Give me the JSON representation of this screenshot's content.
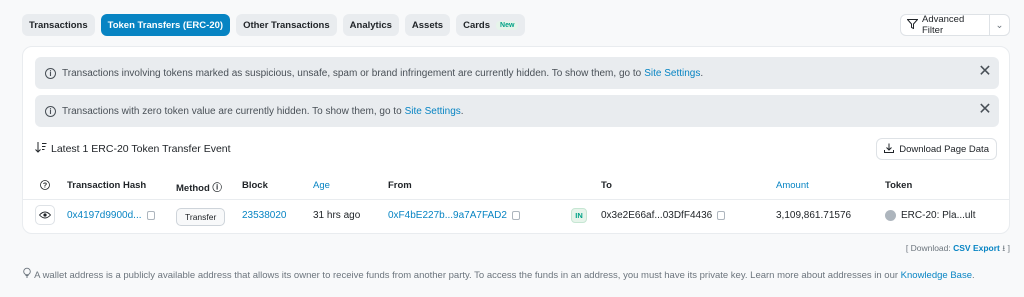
{
  "tabs": [
    {
      "label": "Transactions"
    },
    {
      "label": "Token Transfers (ERC-20)"
    },
    {
      "label": "Other Transactions"
    },
    {
      "label": "Analytics"
    },
    {
      "label": "Assets"
    },
    {
      "label": "Cards",
      "badge": "New"
    }
  ],
  "advanced_filter": {
    "label": "Advanced Filter"
  },
  "alerts": [
    {
      "text": "Transactions involving tokens marked as suspicious, unsafe, spam or brand infringement are currently hidden. To show them, go to",
      "link": "Site Settings",
      "suffix": "."
    },
    {
      "text": "Transactions with zero token value are currently hidden. To show them, go to",
      "link": "Site Settings",
      "suffix": "."
    }
  ],
  "summary": {
    "text": "Latest 1 ERC-20 Token Transfer Event"
  },
  "download_button": {
    "label": "Download Page Data"
  },
  "table": {
    "headers": {
      "hash": "Transaction Hash",
      "method": "Method",
      "block": "Block",
      "age": "Age",
      "from": "From",
      "to": "To",
      "amount": "Amount",
      "token": "Token"
    },
    "rows": [
      {
        "hash": "0x4197d9900d...",
        "method": "Transfer",
        "block": "23538020",
        "age": "31 hrs ago",
        "from": "0xF4bE227b...9a7A7FAD2",
        "direction": "IN",
        "to": "0x3e2E66af...03DfF4436",
        "amount": "3,109,861.71576",
        "token": "ERC-20: Pla...ult"
      }
    ]
  },
  "csv": {
    "prefix": "[ Download:",
    "link": "CSV Export",
    "suffix": "]"
  },
  "footnote": {
    "text": "A wallet address is a publicly available address that allows its owner to receive funds from another party. To access the funds in an address, you must have its private key. Learn more about addresses in our",
    "link": "Knowledge Base",
    "suffix": "."
  },
  "colors": {
    "accent": "#0784c3",
    "in_badge": "#00a186"
  }
}
